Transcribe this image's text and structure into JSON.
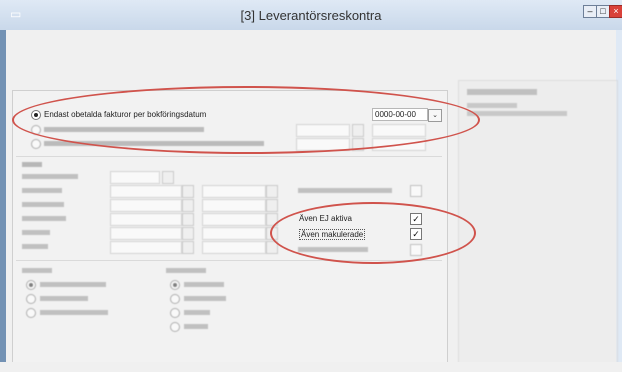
{
  "window": {
    "title": "[3]  Leverantörsreskontra",
    "minimize": "–",
    "maximize": "□",
    "close": "×"
  },
  "filter": {
    "option1_label": "Endast obetalda fakturor per bokföringsdatum",
    "date_value": "0000-00-00"
  },
  "flags": {
    "inactive_label": "Även EJ aktiva",
    "inactive_checked": "✓",
    "cancelled_label": "Även makulerade",
    "cancelled_checked": "✓"
  },
  "icons": {
    "dropdown": "⌄",
    "window_icon": "▭"
  }
}
